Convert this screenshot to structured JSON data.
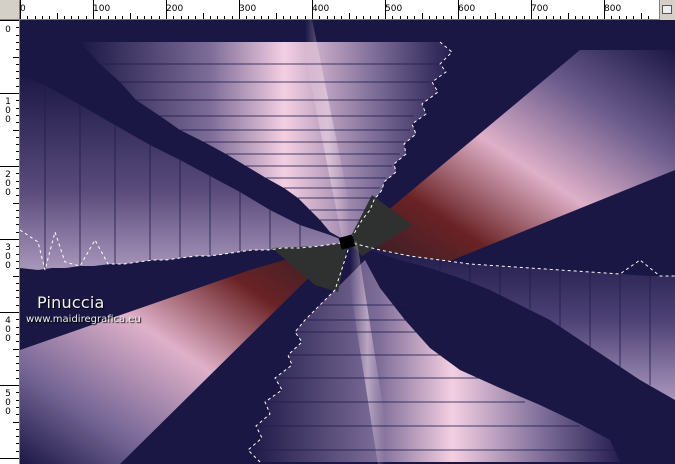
{
  "ruler": {
    "top_labels": [
      "0",
      "100",
      "200",
      "300",
      "400",
      "500",
      "600",
      "700",
      "800"
    ],
    "left_labels": [
      "0",
      "1\n0\n0",
      "2\n0\n0",
      "3\n0\n0",
      "4\n0\n0",
      "5\n0\n0"
    ]
  },
  "watermark": {
    "name": "Pinuccia",
    "url": "www.maidiregrafica.eu"
  },
  "colors": {
    "background": "#1a1745",
    "pink": "#f2c8e0",
    "mauve": "#8a7aa2",
    "maroon": "#6a2020",
    "dark_center": "#2e3130",
    "ruler_bg": "#ffffff",
    "ui_gray": "#d4d0c8"
  }
}
